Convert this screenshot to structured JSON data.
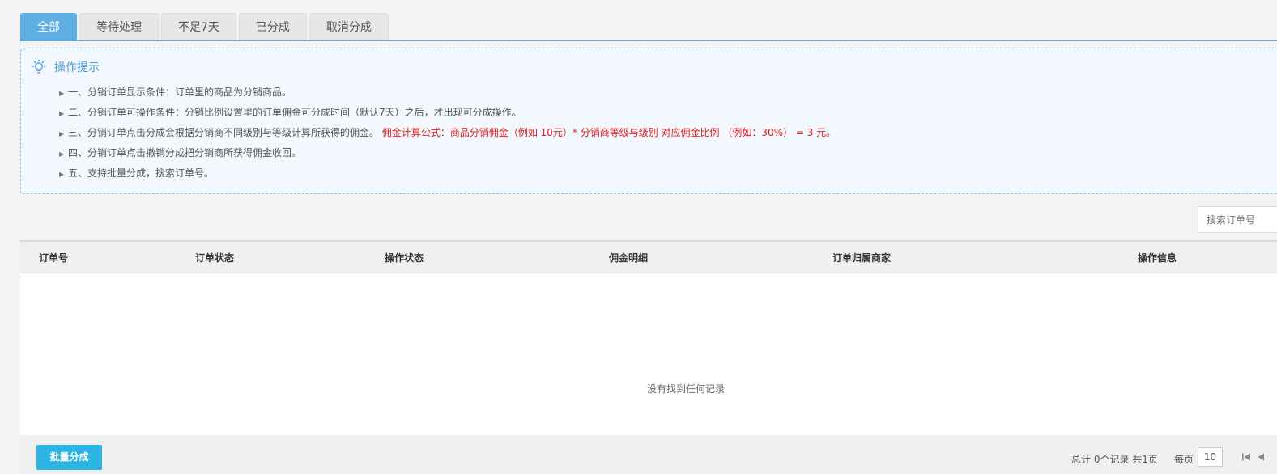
{
  "tabs": [
    {
      "label": "全部",
      "active": true
    },
    {
      "label": "等待处理",
      "active": false
    },
    {
      "label": "不足7天",
      "active": false
    },
    {
      "label": "已分成",
      "active": false
    },
    {
      "label": "取消分成",
      "active": false
    }
  ],
  "tips": {
    "title": "操作提示",
    "icon": "lightbulb-icon",
    "items": [
      "一、分销订单显示条件：订单里的商品为分销商品。",
      "二、分销订单可操作条件：分销比例设置里的订单佣金可分成时间（默认7天）之后，才出现可分成操作。",
      "三、分销订单点击分成会根据分销商不同级别与等级计算所获得的佣金。",
      "四、分销订单点击撤销分成把分销商所获得佣金收回。",
      "五、支持批量分成，搜索订单号。"
    ],
    "formula": "佣金计算公式：商品分销佣金（例如 10元）* 分销商等级与级别 对应佣金比例 （例如：30%） = 3 元。"
  },
  "search": {
    "placeholder": "搜索订单号"
  },
  "table": {
    "columns": [
      "订单号",
      "订单状态",
      "操作状态",
      "佣金明细",
      "订单归属商家",
      "操作信息"
    ],
    "empty_text": "没有找到任何记录"
  },
  "footer": {
    "batch_button": "批量分成",
    "summary": "总计 0个记录 共1页",
    "per_page_label": "每页",
    "per_page_value": "10"
  },
  "colors": {
    "accent": "#5faee3",
    "button": "#2eb4e3",
    "highlight": "#e02020"
  }
}
